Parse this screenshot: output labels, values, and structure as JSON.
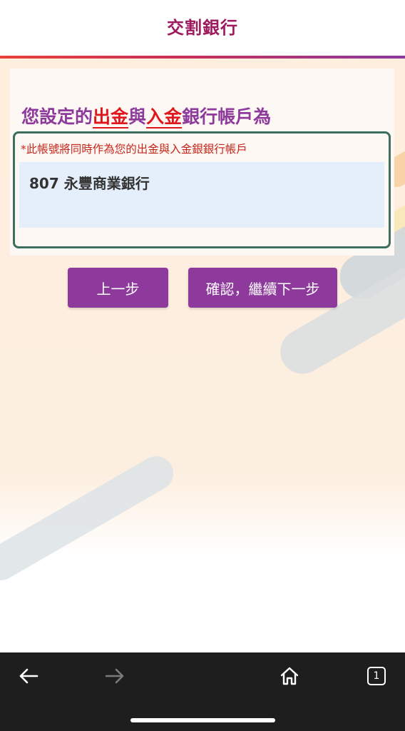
{
  "header": {
    "title": "交割銀行"
  },
  "card": {
    "title_part1": "您設定的",
    "title_highlight1": "出金",
    "title_part2": "與",
    "title_highlight2": "入金",
    "title_part3": "銀行帳戶為",
    "note": "*此帳號將同時作為您的出金與入金銀銀行帳戶",
    "account_value": "807 永豐商業銀行"
  },
  "buttons": {
    "prev_label": "上一步",
    "next_label": "確認，繼續下一步"
  },
  "browser": {
    "tab_count": "1",
    "icons": [
      "back-arrow-icon",
      "forward-arrow-icon",
      "home-icon",
      "tabs-icon"
    ]
  },
  "colors": {
    "brand_purple": "#8e3a9d",
    "header_title": "#9c1a5d",
    "highlight_red": "#e0161d",
    "box_border": "#3d6e5e",
    "field_bg": "#e5eefb"
  }
}
